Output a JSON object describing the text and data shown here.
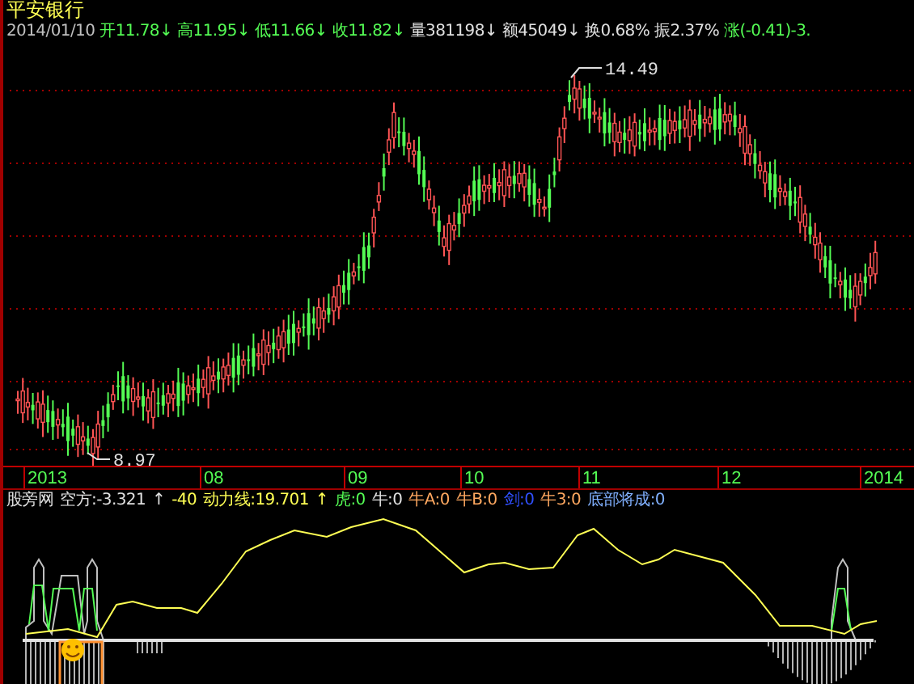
{
  "title": "平安银行",
  "quote": [
    {
      "text": "2014/01/10",
      "color": "#c0c0c0"
    },
    {
      "text": "开11.78↓",
      "color": "#54fc54"
    },
    {
      "text": "高11.95↓",
      "color": "#54fc54"
    },
    {
      "text": "低11.66↓",
      "color": "#54fc54"
    },
    {
      "text": "收11.82↓",
      "color": "#54fc54"
    },
    {
      "text": "量381198↓",
      "color": "#e0e0e0"
    },
    {
      "text": "额45049↓",
      "color": "#e0e0e0"
    },
    {
      "text": "换0.68%",
      "color": "#e0e0e0"
    },
    {
      "text": "振2.37%",
      "color": "#e0e0e0"
    },
    {
      "text": "涨(-0.41)-3.",
      "color": "#54fc54"
    }
  ],
  "price_marks": {
    "high": "14.49",
    "low": "8.97"
  },
  "x_axis": [
    "2013",
    "08",
    "09",
    "10",
    "11",
    "12",
    "2014"
  ],
  "indicator": [
    {
      "text": "股旁网",
      "color": "#e0e0e0"
    },
    {
      "text": "空方:-3.321",
      "color": "#e0e0e0"
    },
    {
      "text": "↑",
      "color": "#e0e0e0"
    },
    {
      "text": "-40",
      "color": "#ffff54"
    },
    {
      "text": "动力线:19.701",
      "color": "#ffff54"
    },
    {
      "text": "↑",
      "color": "#ffff54"
    },
    {
      "text": "虎:0",
      "color": "#54fc54"
    },
    {
      "text": "牛:0",
      "color": "#e0e0e0"
    },
    {
      "text": "牛A:0",
      "color": "#ffa860"
    },
    {
      "text": "牛B:0",
      "color": "#ffa860"
    },
    {
      "text": "剑:0",
      "color": "#3050ff"
    },
    {
      "text": "牛3:0",
      "color": "#ffa860"
    },
    {
      "text": "底部将成:0",
      "color": "#80b0ff"
    }
  ]
}
